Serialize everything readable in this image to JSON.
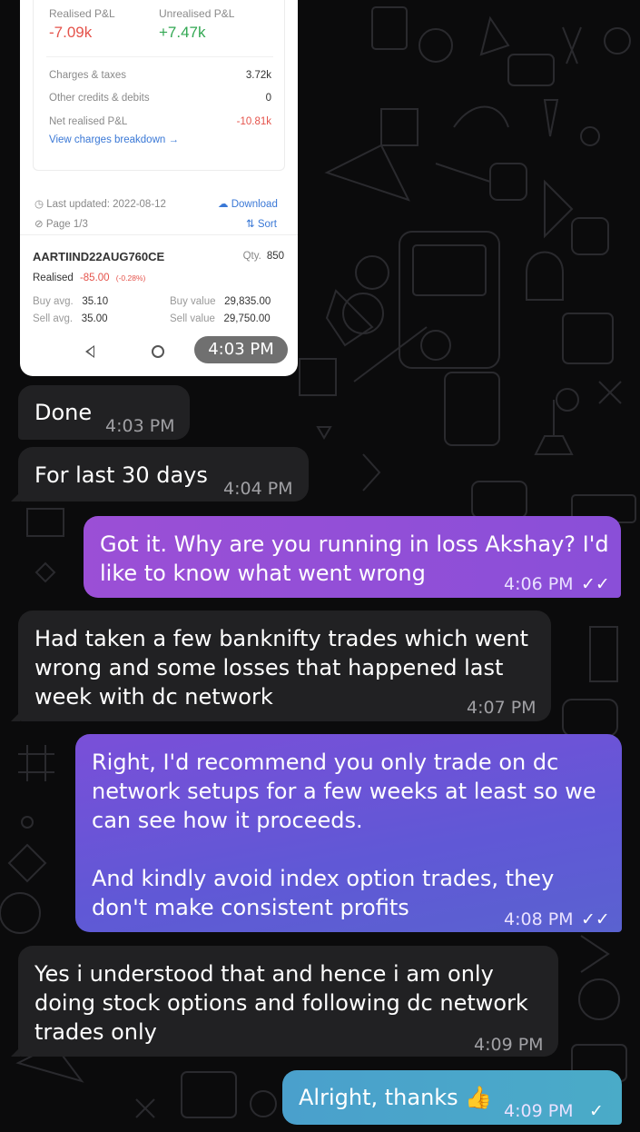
{
  "screenshot": {
    "realised_label": "Realised P&L",
    "realised_value": "-7.09k",
    "unrealised_label": "Unrealised P&L",
    "unrealised_value": "+7.47k",
    "charges": [
      {
        "label": "Charges & taxes",
        "value": "3.72k"
      },
      {
        "label": "Other credits & debits",
        "value": "0"
      },
      {
        "label": "Net realised P&L",
        "value": "-10.81k"
      }
    ],
    "charges_link": "View charges breakdown →",
    "last_updated": "Last updated: 2022-08-12",
    "download": "Download",
    "page": "Page 1/3",
    "sort": "Sort",
    "symbol": "AARTIIND22AUG760CE",
    "qty_label": "Qty.",
    "qty_value": "850",
    "realised_row_label": "Realised",
    "realised_row_value": "-85.00",
    "realised_row_pct": "(-0.28%)",
    "buy_avg_label": "Buy avg.",
    "buy_avg_value": "35.10",
    "sell_avg_label": "Sell avg.",
    "sell_avg_value": "35.00",
    "buy_value_label": "Buy value",
    "buy_value_value": "29,835.00",
    "sell_value_label": "Sell value",
    "sell_value_value": "29,750.00",
    "time": "4:03 PM"
  },
  "messages": [
    {
      "dir": "in",
      "text": "Done",
      "time": "4:03 PM"
    },
    {
      "dir": "in",
      "text": "For last 30 days",
      "time": "4:04 PM"
    },
    {
      "dir": "out",
      "text": "Got it. Why are you running in loss Akshay? I'd\nlike to know what went wrong",
      "time": "4:06 PM",
      "status": "read"
    },
    {
      "dir": "in",
      "text": "Had taken a few banknifty trades which went\nwrong and some losses that happened last\nweek with dc network",
      "time": "4:07 PM"
    },
    {
      "dir": "out",
      "text": "Right, I'd recommend you only trade on dc\nnetwork setups for a few weeks at least so we\ncan see how it proceeds.\n\nAnd kindly avoid index option trades, they\ndon't make consistent profits",
      "time": "4:08 PM",
      "status": "read"
    },
    {
      "dir": "in",
      "text": "Yes i understood that and hence i am only\ndoing stock options and following dc network\ntrades only",
      "time": "4:09 PM"
    },
    {
      "dir": "out",
      "text": "Alright, thanks 👍",
      "time": "4:09 PM",
      "status": "sent"
    }
  ],
  "status_icons": {
    "read": "✓✓",
    "sent": "✓"
  },
  "colors": {
    "background": "#0b0b0c",
    "incoming_bubble": "#212123",
    "outgoing_gradient_1": "#9b4fd6",
    "outgoing_gradient_2": "#6a52d8",
    "outgoing_gradient_3": "#4aa8c8",
    "loss_red": "#e5534b",
    "profit_green": "#33a853"
  }
}
